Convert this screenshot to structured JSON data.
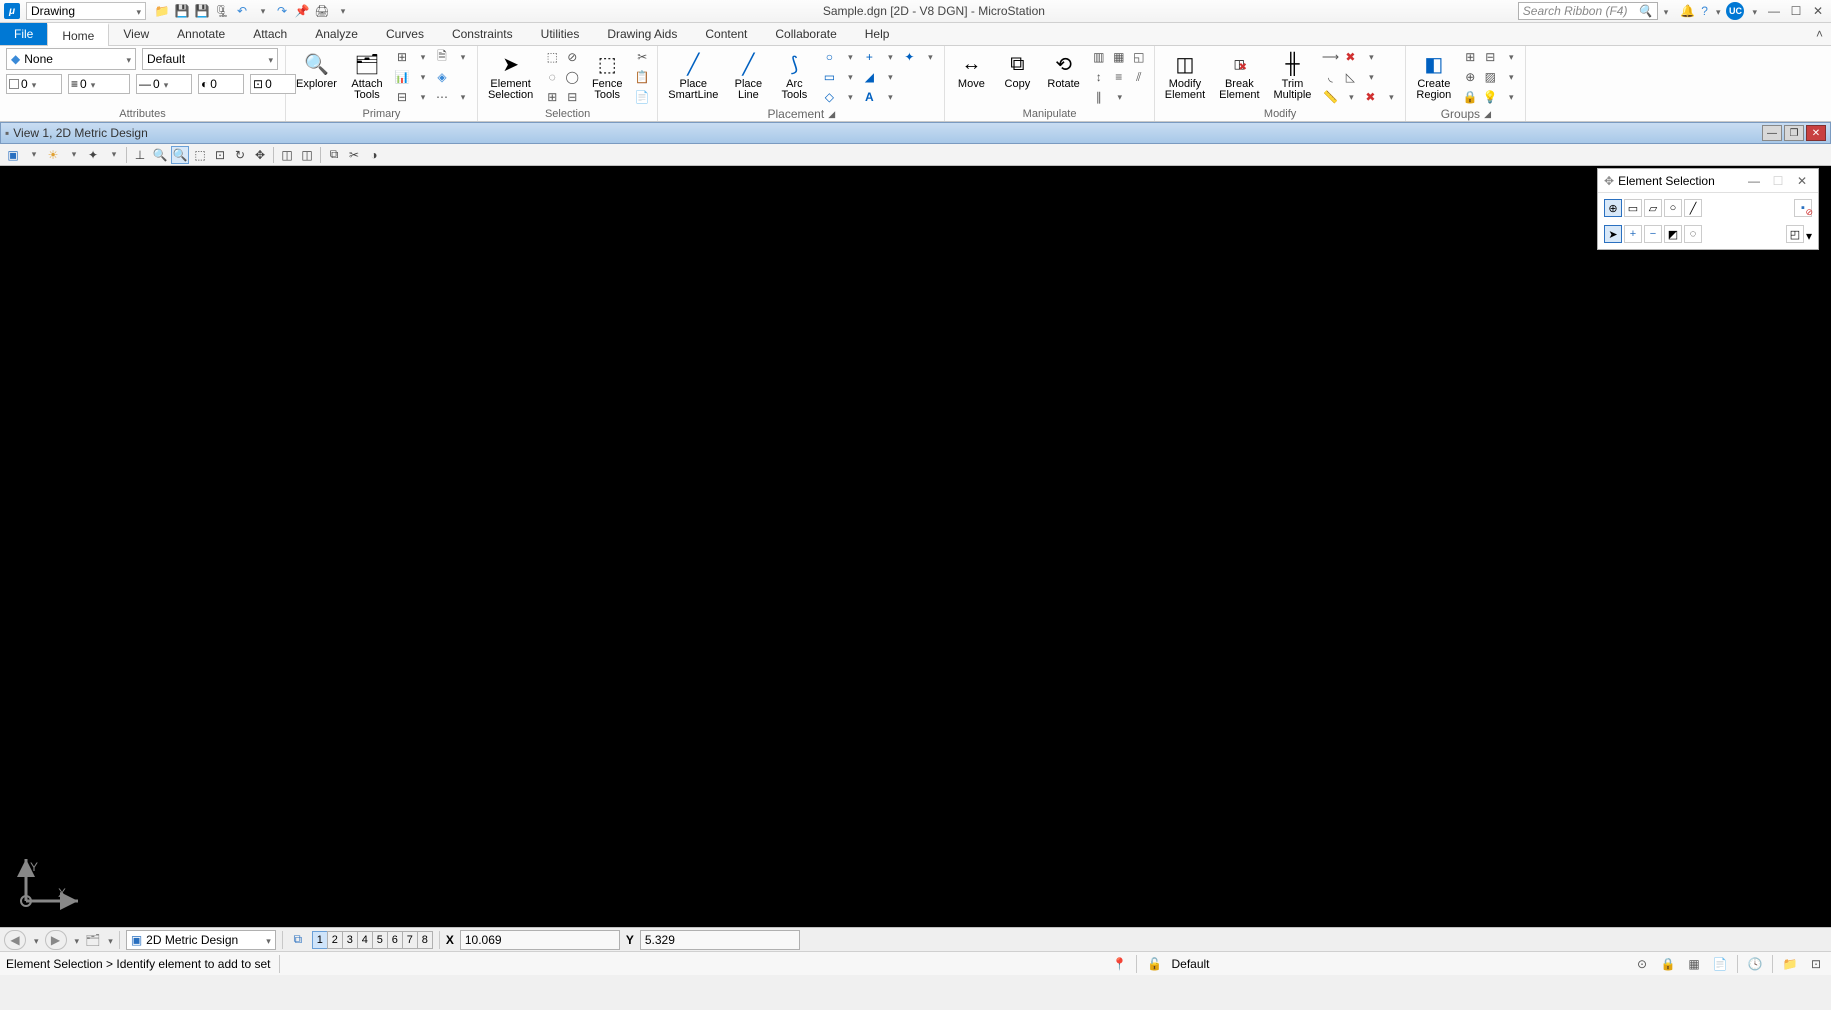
{
  "title_bar": {
    "workspace": "Drawing",
    "document_title": "Sample.dgn [2D - V8 DGN] - MicroStation",
    "search_placeholder": "Search Ribbon (F4)",
    "user_initials": "UC"
  },
  "ribbon_tabs": [
    "File",
    "Home",
    "View",
    "Annotate",
    "Attach",
    "Analyze",
    "Curves",
    "Constraints",
    "Utilities",
    "Drawing Aids",
    "Content",
    "Collaborate",
    "Help"
  ],
  "active_tab": "Home",
  "attributes": {
    "level": "None",
    "style": "Default",
    "color": "0",
    "lineweight": "0",
    "linestyle": "0",
    "transparency": "0",
    "priority": "0",
    "group_label": "Attributes"
  },
  "groups": {
    "primary": {
      "label": "Primary",
      "explorer": "Explorer",
      "attach_tools": "Attach\nTools"
    },
    "selection": {
      "label": "Selection",
      "element_selection": "Element\nSelection",
      "fence_tools": "Fence\nTools"
    },
    "placement": {
      "label": "Placement",
      "place_smartline": "Place\nSmartLine",
      "place_line": "Place\nLine",
      "arc_tools": "Arc\nTools"
    },
    "manipulate": {
      "label": "Manipulate",
      "move": "Move",
      "copy": "Copy",
      "rotate": "Rotate"
    },
    "modify": {
      "label": "Modify",
      "modify_element": "Modify\nElement",
      "break_element": "Break\nElement",
      "trim_multiple": "Trim\nMultiple"
    },
    "groups": {
      "label": "Groups",
      "create_region": "Create\nRegion"
    }
  },
  "view_window": {
    "caption": "View 1, 2D Metric Design"
  },
  "element_selection_palette": {
    "title": "Element Selection"
  },
  "model_bar": {
    "model_name": "2D Metric Design",
    "view_numbers": [
      "1",
      "2",
      "3",
      "4",
      "5",
      "6",
      "7",
      "8"
    ],
    "x_label": "X",
    "x_value": "10.069",
    "y_label": "Y",
    "y_value": "5.329"
  },
  "status_bar": {
    "prompt": "Element Selection > Identify element to add to set",
    "level": "Default"
  }
}
